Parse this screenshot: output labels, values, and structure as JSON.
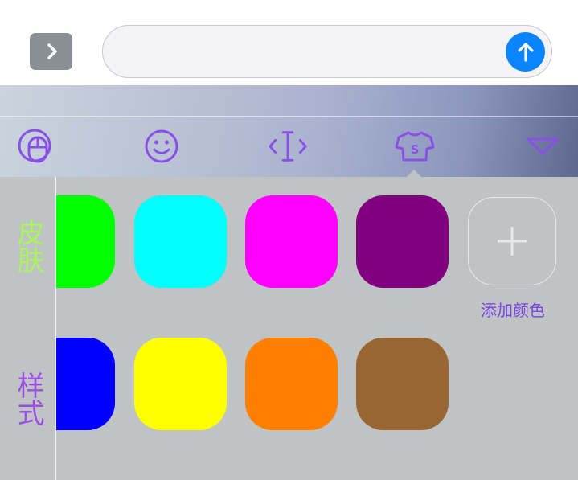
{
  "message_bar": {
    "input_value": "",
    "placeholder": ""
  },
  "toolbar": {
    "icons": [
      "mouse-icon",
      "emoji-icon",
      "cursor-icon",
      "tshirt-icon",
      "collapse-icon"
    ],
    "accent_color": "#8b4fe8"
  },
  "side_tabs": {
    "skin_label": "皮肤",
    "style_label": "样式",
    "skin_color": "#a8f55a",
    "style_color": "#9b4fe0"
  },
  "swatches": {
    "row1": [
      "#00ff00",
      "#00ffff",
      "#ff00ff",
      "#800080"
    ],
    "row2": [
      "#0000ff",
      "#ffff00",
      "#ff8000",
      "#996633"
    ]
  },
  "add_color": {
    "label": "添加颜色"
  }
}
